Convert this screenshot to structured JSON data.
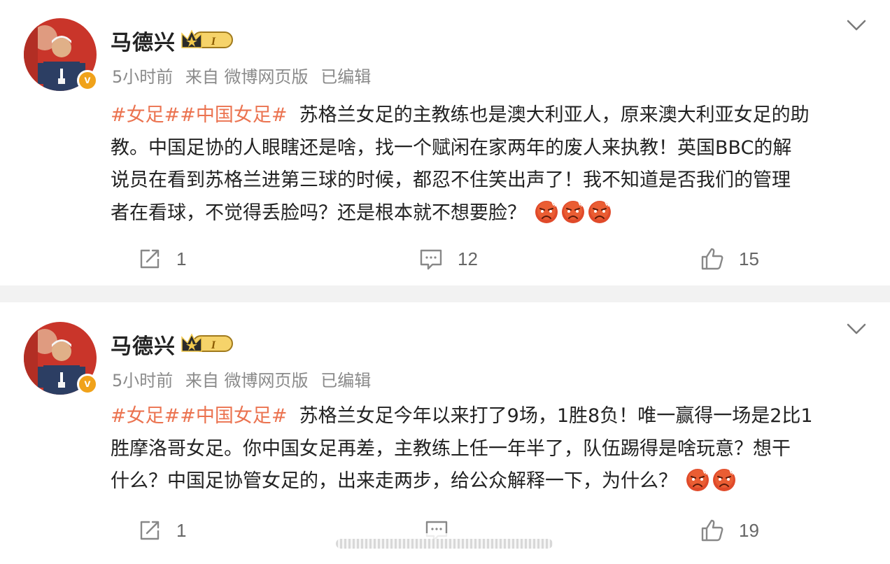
{
  "posts": [
    {
      "author": "马德兴",
      "verified_mark": "v",
      "time": "5小时前",
      "source": "来自 微博网页版",
      "edited": "已编辑",
      "topics": [
        "#女足#",
        "#中国女足#"
      ],
      "text_lines": [
        "苏格兰女足的主教练也是澳大利亚人，原来澳大利亚女足的助",
        "教。中国足协的人眼瞎还是啥，找一个赋闲在家两年的废人来执教！英国BBC的解",
        "说员在看到苏格兰进第三球的时候，都忍不住笑出声了！我不知道是否我们的管理",
        "者在看球，不觉得丢脸吗？还是根本就不想要脸？"
      ],
      "emoji_count_label": "angry-emoji x3",
      "repost_count": "1",
      "comment_count": "12",
      "like_count": "15"
    },
    {
      "author": "马德兴",
      "verified_mark": "v",
      "time": "5小时前",
      "source": "来自 微博网页版",
      "edited": "已编辑",
      "topics": [
        "#女足#",
        "#中国女足#"
      ],
      "text_lines": [
        "苏格兰女足今年以来打了9场，1胜8负！唯一赢得一场是2比1",
        "胜摩洛哥女足。你中国女足再差，主教练上任一年半了，队伍踢得是啥玩意？想干",
        "什么？中国足协管女足的，出来走两步，给公众解释一下，为什么？"
      ],
      "emoji_count_label": "angry-emoji x2",
      "repost_count": "1",
      "comment_count": "",
      "like_count": "19"
    }
  ],
  "colors": {
    "topic": "#eb7350",
    "meta": "#8a8a8a",
    "verified": "#f0a21a",
    "background": "#f2f2f2"
  }
}
